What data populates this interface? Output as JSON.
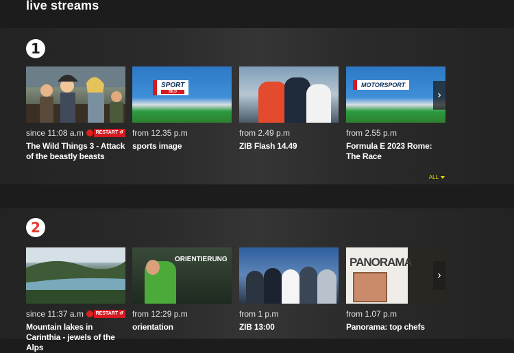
{
  "page": {
    "title": "live streams"
  },
  "rows": [
    {
      "channel_logo": "1",
      "all_label": "ALL",
      "cards": [
        {
          "time": "since 11:08 a.m",
          "live": true,
          "restart": "RESTART",
          "title": "The Wild Things 3 - Attack of the beastly beasts"
        },
        {
          "time": "from 12.35 p.m",
          "title": "sports image",
          "thumb_text": "SPORT",
          "thumb_sub": "BILD"
        },
        {
          "time": "from 2.49 p.m",
          "title": "ZIB Flash 14.49"
        },
        {
          "time": "from 2.55 p.m",
          "title": "Formula E 2023 Rome: The Race",
          "thumb_text": "MOTORSPORT"
        }
      ]
    },
    {
      "channel_logo": "2",
      "cards": [
        {
          "time": "since 11:37 a.m",
          "live": true,
          "restart": "RESTART",
          "title": "Mountain lakes in Carinthia - jewels of the Alps"
        },
        {
          "time": "from 12:29 p.m",
          "title": "orientation",
          "thumb_text": "ORIENTIERUNG"
        },
        {
          "time": "from 1 p.m",
          "title": "ZIB 13:00"
        },
        {
          "time": "from 1.07 p.m",
          "title": "Panorama: top chefs",
          "thumb_text": "PANORAMA"
        }
      ]
    }
  ],
  "colors": {
    "accent_yellow": "#f2d600",
    "live_red": "#e0201b",
    "restart_red": "#d71920"
  }
}
